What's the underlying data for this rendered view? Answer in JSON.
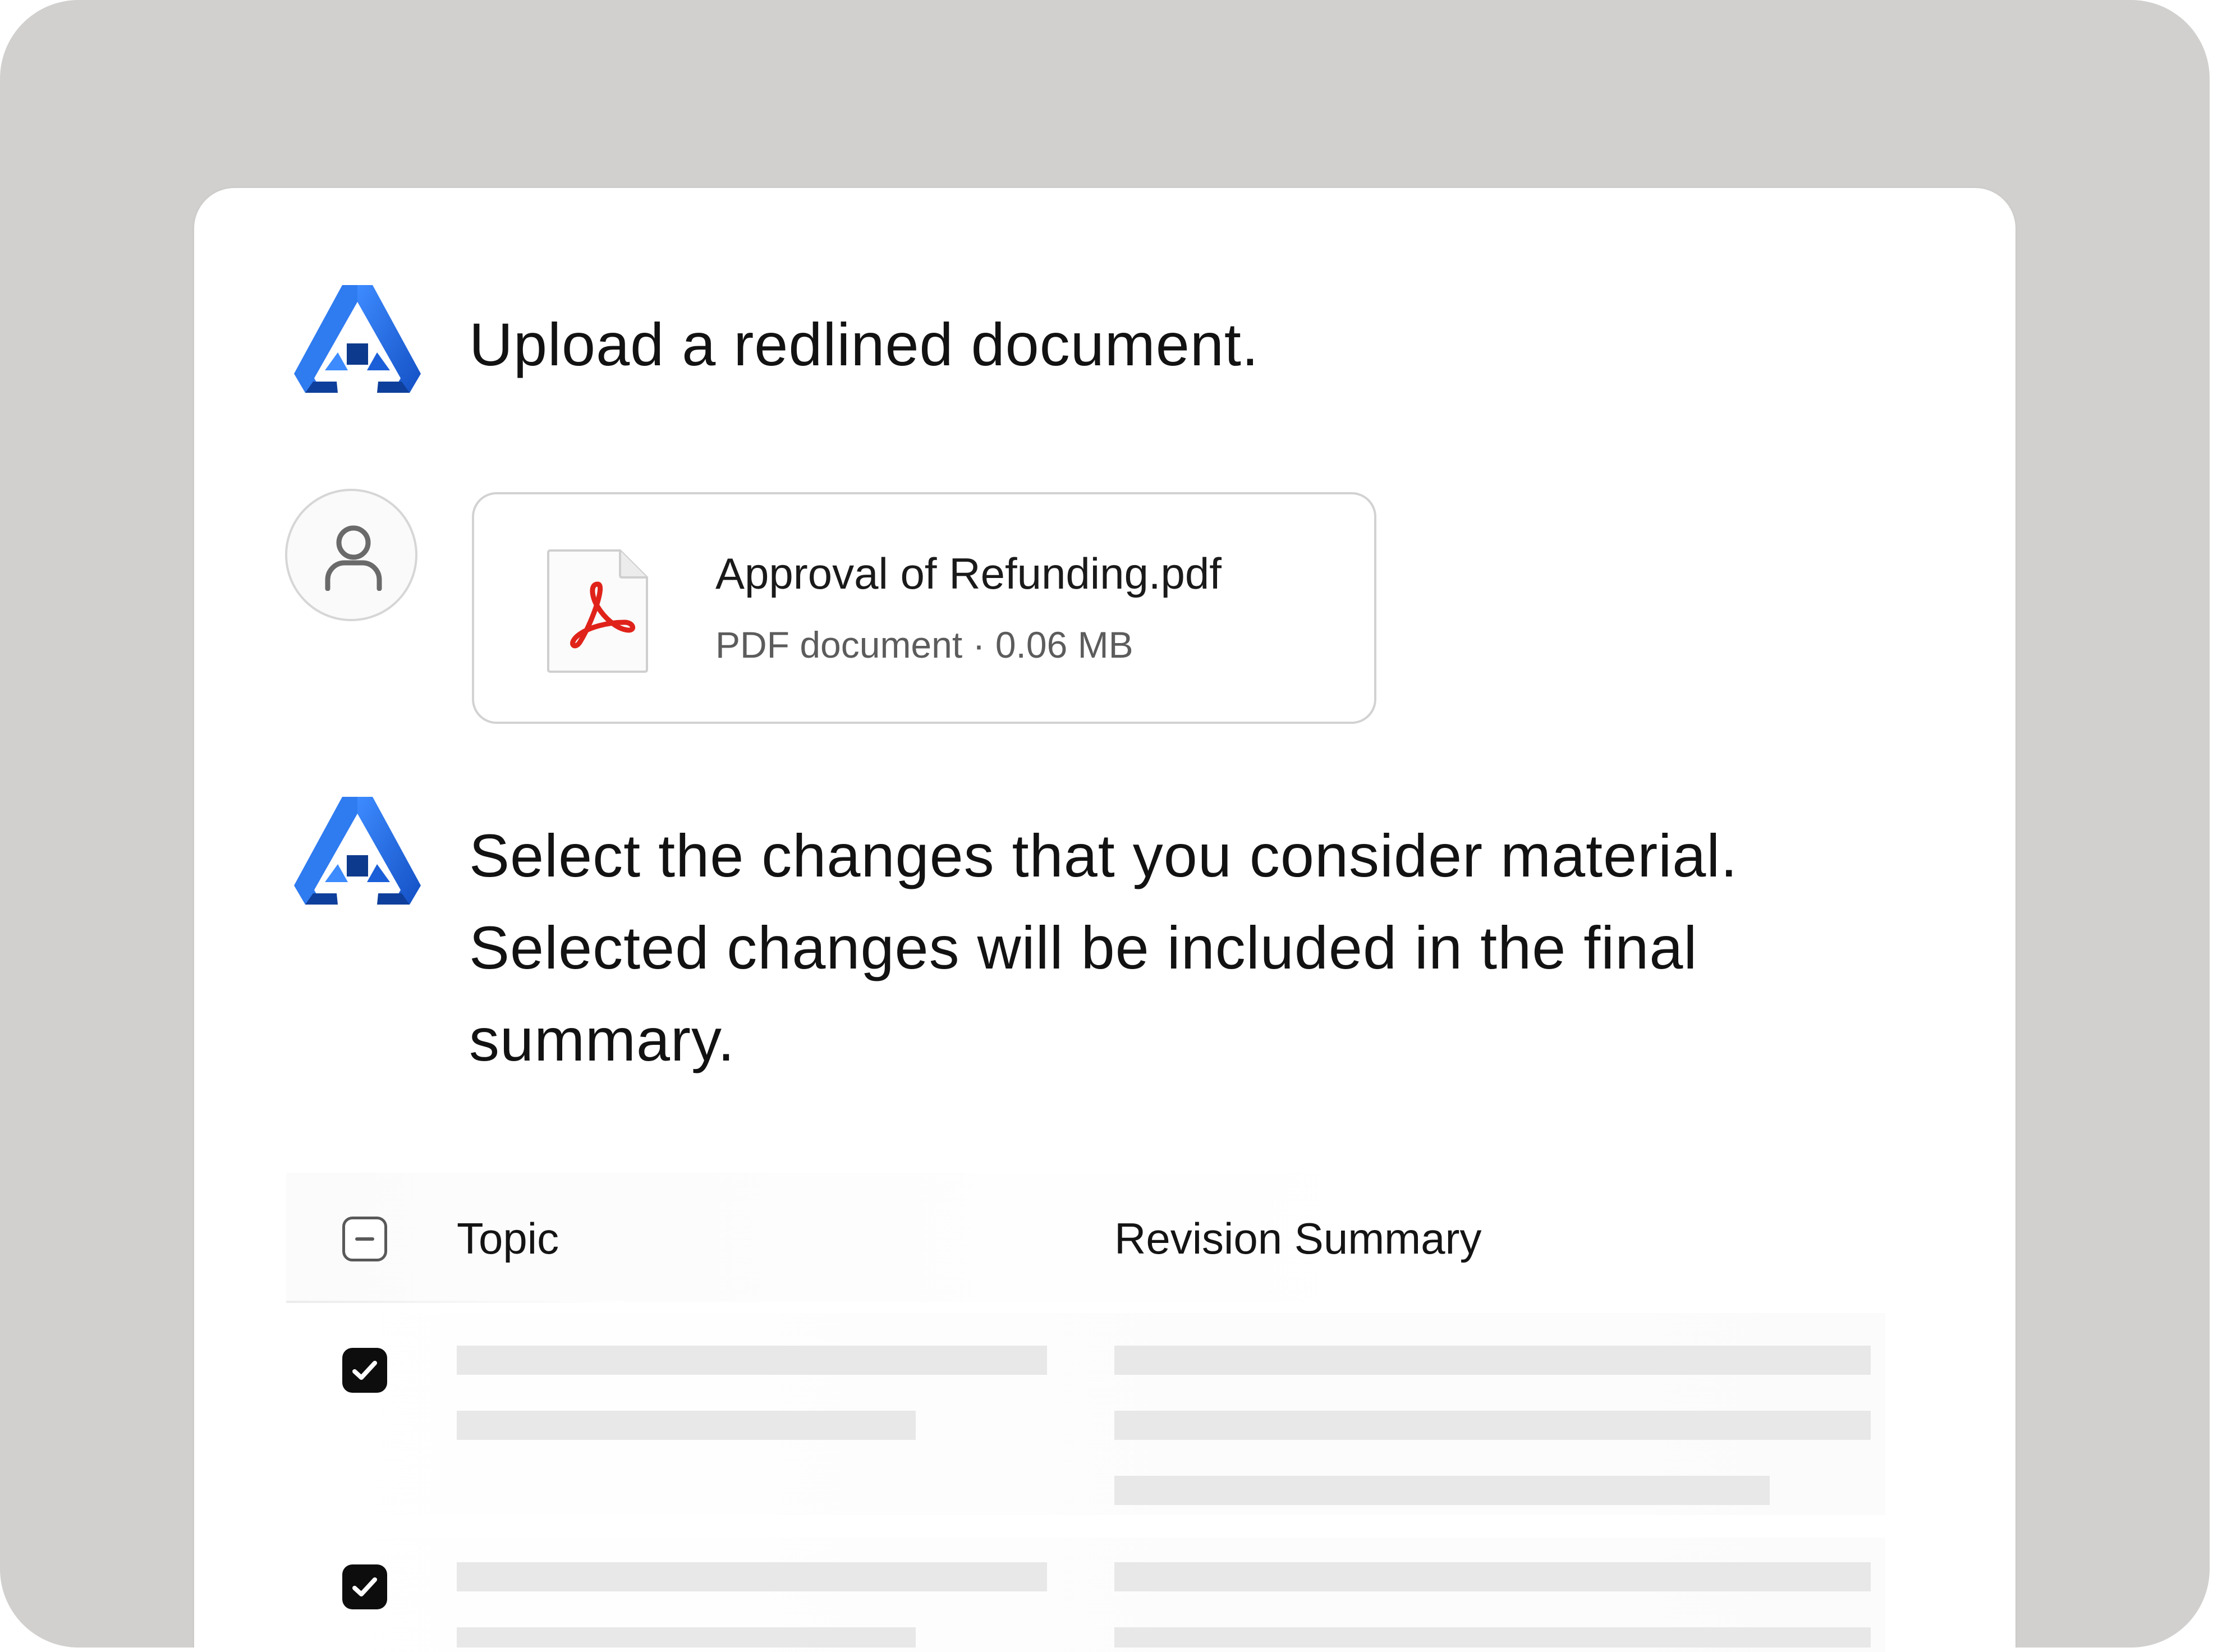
{
  "chat": {
    "bot_message_1": "Upload a redlined document.",
    "bot_message_2": "Select the changes that you consider material. Selected changes will be included in the final summary."
  },
  "attachment": {
    "file_name": "Approval of Refunding.pdf",
    "file_meta": "PDF document · 0.06 MB",
    "icon": "pdf-icon"
  },
  "table": {
    "columns": [
      "Topic",
      "Revision Summary"
    ],
    "header_checkbox_state": "indeterminate",
    "rows": [
      {
        "selected": true
      },
      {
        "selected": true
      }
    ]
  },
  "icons": {
    "bot": "triangle-logo-icon",
    "user": "user-avatar-icon",
    "check": "checkmark-icon"
  },
  "colors": {
    "logo_blue": "#1f6fe0",
    "logo_navy": "#0d3a8c",
    "pdf_red": "#e0231a",
    "checkbox_checked": "#0d0d0d"
  }
}
